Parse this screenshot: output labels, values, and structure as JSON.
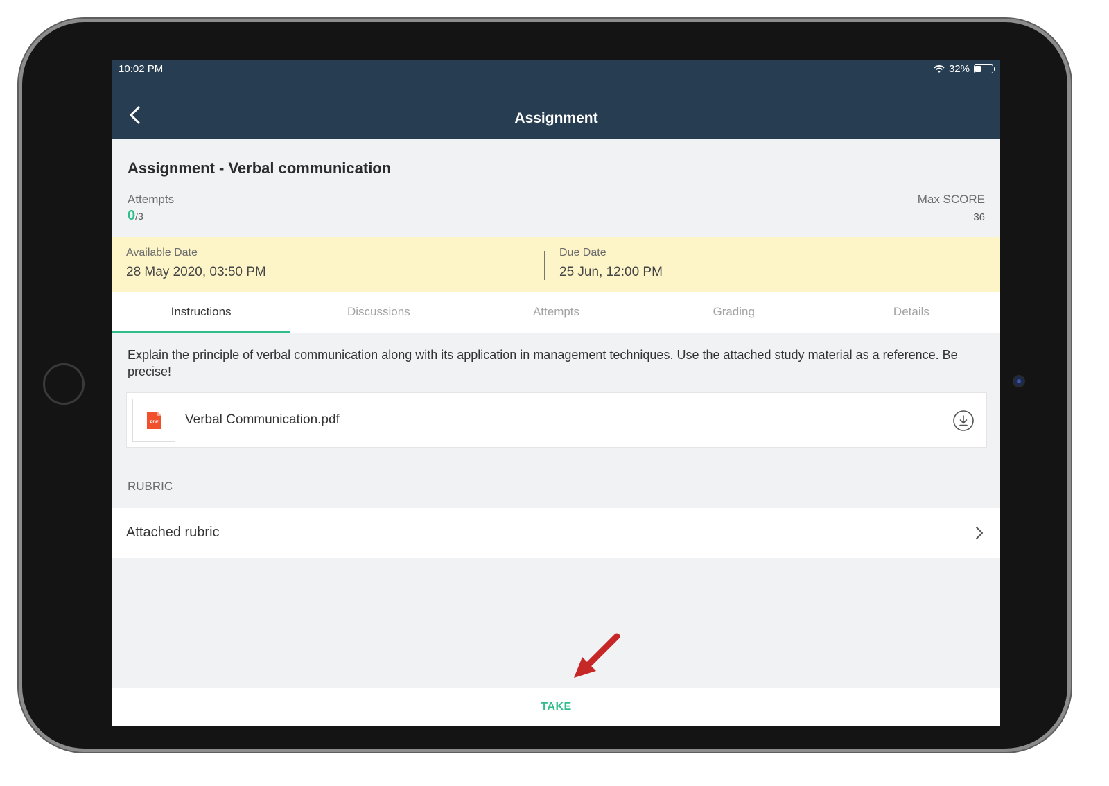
{
  "status_bar": {
    "time": "10:02 PM",
    "battery": "32%",
    "battery_level": 0.32
  },
  "nav": {
    "title": "Assignment"
  },
  "assignment": {
    "title": "Assignment - Verbal communication",
    "attempts_label": "Attempts",
    "attempts_used": "0",
    "attempts_total": "/3",
    "max_score_label": "Max SCORE",
    "max_score": "36"
  },
  "dates": {
    "available_label": "Available Date",
    "available_value": "28 May 2020, 03:50 PM",
    "due_label": "Due Date",
    "due_value": "25 Jun, 12:00 PM"
  },
  "tabs": [
    {
      "label": "Instructions",
      "active": true
    },
    {
      "label": "Discussions",
      "active": false
    },
    {
      "label": "Attempts",
      "active": false
    },
    {
      "label": "Grading",
      "active": false
    },
    {
      "label": "Details",
      "active": false
    }
  ],
  "instructions_text": "Explain the principle of verbal communication along with its application in management techniques. Use the attached study material as a reference. Be precise!",
  "attachment": {
    "file_name": "Verbal Communication.pdf",
    "icon": "pdf-file-icon",
    "badge": "PDF"
  },
  "rubric": {
    "section_label": "RUBRIC",
    "row_label": "Attached rubric"
  },
  "action": {
    "take_label": "TAKE"
  },
  "colors": {
    "header": "#273e52",
    "accent": "#2ebd8b",
    "date_band": "#fdf4c8",
    "pdf_red": "#f0502b",
    "annotation_arrow": "#c62828"
  }
}
